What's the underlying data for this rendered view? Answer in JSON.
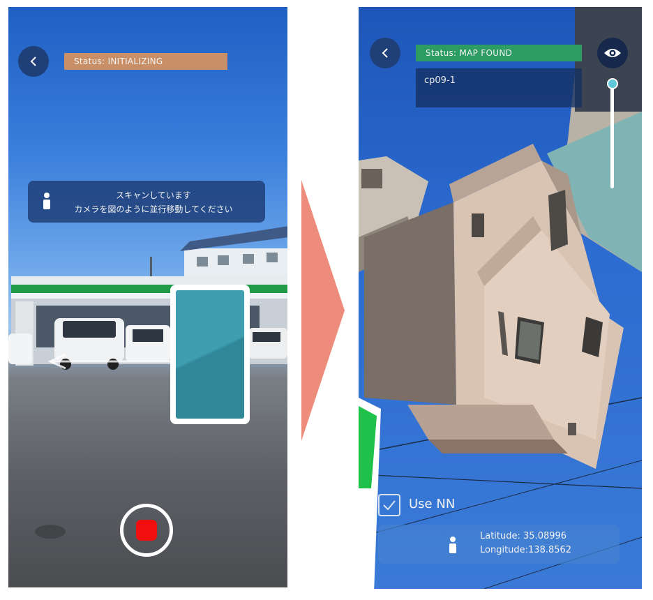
{
  "left_screen": {
    "status": "Status: INITIALIZING",
    "hint": {
      "line1": "スキャンしています",
      "line2": "カメラを図のように並行移動してください"
    },
    "icons": {
      "back": "chevron-left-icon",
      "hint": "person-icon",
      "guide": "phone-guide-icon",
      "record": "record-icon"
    },
    "colors": {
      "status_bg": "#c98f66",
      "record": "#f00e0e",
      "guide": "#3f9eb0"
    }
  },
  "arrow": {
    "color": "#ee8c7c",
    "icon": "arrow-right-icon"
  },
  "right_screen": {
    "status": "Status: MAP FOUND",
    "map_name": "cp09-1",
    "use_nn_label": "Use NN",
    "use_nn_checked": true,
    "latitude": "Latitude: 35.08996",
    "longitude": "Longitude:138.8562",
    "icons": {
      "back": "chevron-left-icon",
      "visibility": "eye-icon",
      "geo": "person-icon",
      "check": "checkmark-icon"
    },
    "colors": {
      "status_bg": "#2c9c63",
      "slider_thumb": "#5fc7da"
    }
  }
}
